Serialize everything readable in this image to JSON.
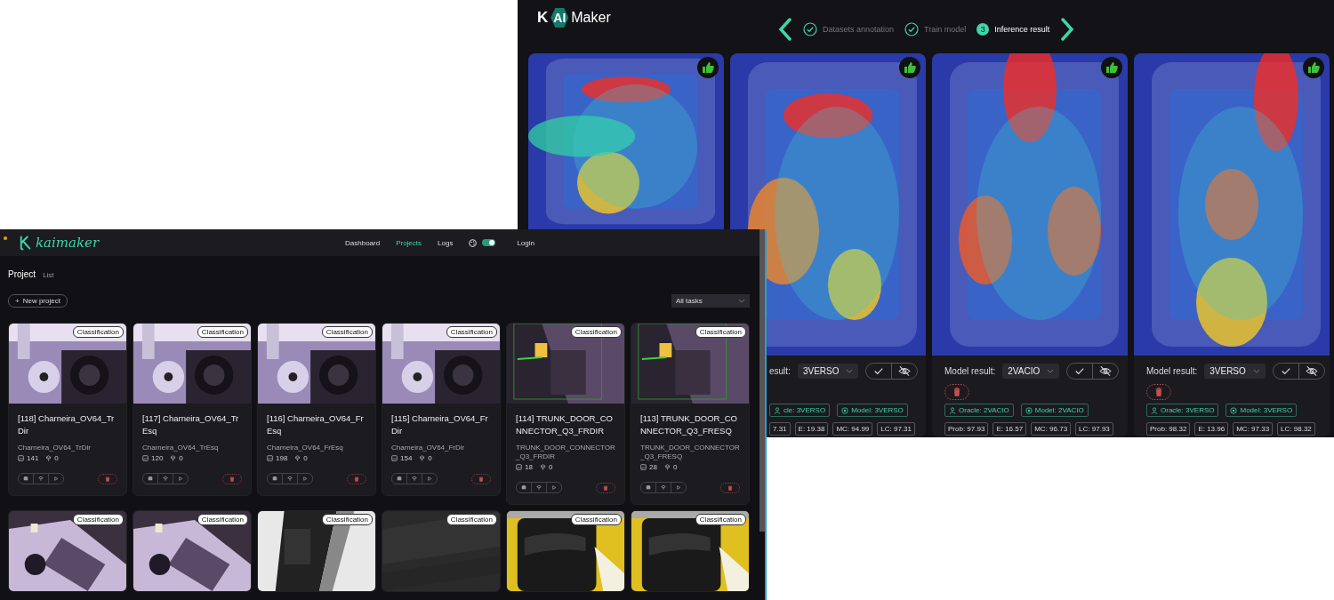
{
  "inference_window": {
    "logo": {
      "letter": "K",
      "badge": "AI",
      "word": "Maker"
    },
    "steps": [
      {
        "label": "Datasets annotation",
        "completed": true,
        "selected": false
      },
      {
        "label": "Train model",
        "completed": true,
        "selected": false
      },
      {
        "number": "3",
        "label": "Inference result",
        "completed": false,
        "selected": true
      }
    ],
    "panels": [
      {
        "kind": "image-only",
        "liked": true
      },
      {
        "kind": "partial",
        "liked": true,
        "label": "esult:",
        "value": "3VERSO",
        "oracle": "cle: 3VERSO",
        "model": "Model: 3VERSO",
        "metrics": [
          "7.31",
          "E: 19.38",
          "MC: 94.99",
          "LC: 97.31"
        ]
      },
      {
        "kind": "full",
        "liked": true,
        "label": "Model result:",
        "value": "2VACIO",
        "oracle": "Oracle: 2VACIO",
        "model": "Model: 2VACIO",
        "metrics": [
          "Prob: 97.93",
          "E: 16.57",
          "MC: 96.73",
          "LC: 97.93"
        ]
      },
      {
        "kind": "full",
        "liked": true,
        "label": "Model result:",
        "value": "3VERSO",
        "oracle": "Oracle: 3VERSO",
        "model": "Model: 3VERSO",
        "metrics": [
          "Prob: 98.32",
          "E: 13.96",
          "MC: 97.33",
          "LC: 98.32"
        ]
      }
    ]
  },
  "projects_window": {
    "logo": "kaimaker",
    "nav": [
      {
        "label": "Dashboard",
        "selected": false
      },
      {
        "label": "Projects",
        "selected": true
      },
      {
        "label": "Logs",
        "selected": false
      }
    ],
    "theme_toggle": {
      "on": true
    },
    "login": "Login",
    "title": "Project",
    "subtitle": "List",
    "new_project": {
      "icon": "+",
      "label": "New project"
    },
    "filter": {
      "value": "All tasks"
    },
    "cards": [
      {
        "badge": "Classification",
        "title": "[118] Charneira_OV64_TrDir",
        "subtitle": "Charneira_OV64_TrDir",
        "images": "141",
        "models": "0"
      },
      {
        "badge": "Classification",
        "title": "[117] Charneira_OV64_TrEsq",
        "subtitle": "Charneira_OV64_TrEsq",
        "images": "120",
        "models": "0"
      },
      {
        "badge": "Classification",
        "title": "[116] Charneira_OV64_FrEsq",
        "subtitle": "Charneira_OV64_FrEsq",
        "images": "198",
        "models": "0"
      },
      {
        "badge": "Classification",
        "title": "[115] Charneira_OV64_FrDir",
        "subtitle": "Charneira_OV64_FrDir",
        "images": "154",
        "models": "0"
      },
      {
        "badge": "Classification",
        "title": "[114] TRUNK_DOOR_CONNECTOR_Q3_FRDIR",
        "subtitle": "TRUNK_DOOR_CONNECTOR_Q3_FRDIR",
        "images": "18",
        "models": "0"
      },
      {
        "badge": "Classification",
        "title": "[113] TRUNK_DOOR_CONNECTOR_Q3_FRESQ",
        "subtitle": "TRUNK_DOOR_CONNECTOR_Q3_FRESQ",
        "images": "28",
        "models": "0"
      },
      {
        "badge": "Classification"
      },
      {
        "badge": "Classification"
      },
      {
        "badge": "Classification"
      },
      {
        "badge": "Classification"
      },
      {
        "badge": "Classification"
      },
      {
        "badge": "Classification"
      }
    ]
  }
}
